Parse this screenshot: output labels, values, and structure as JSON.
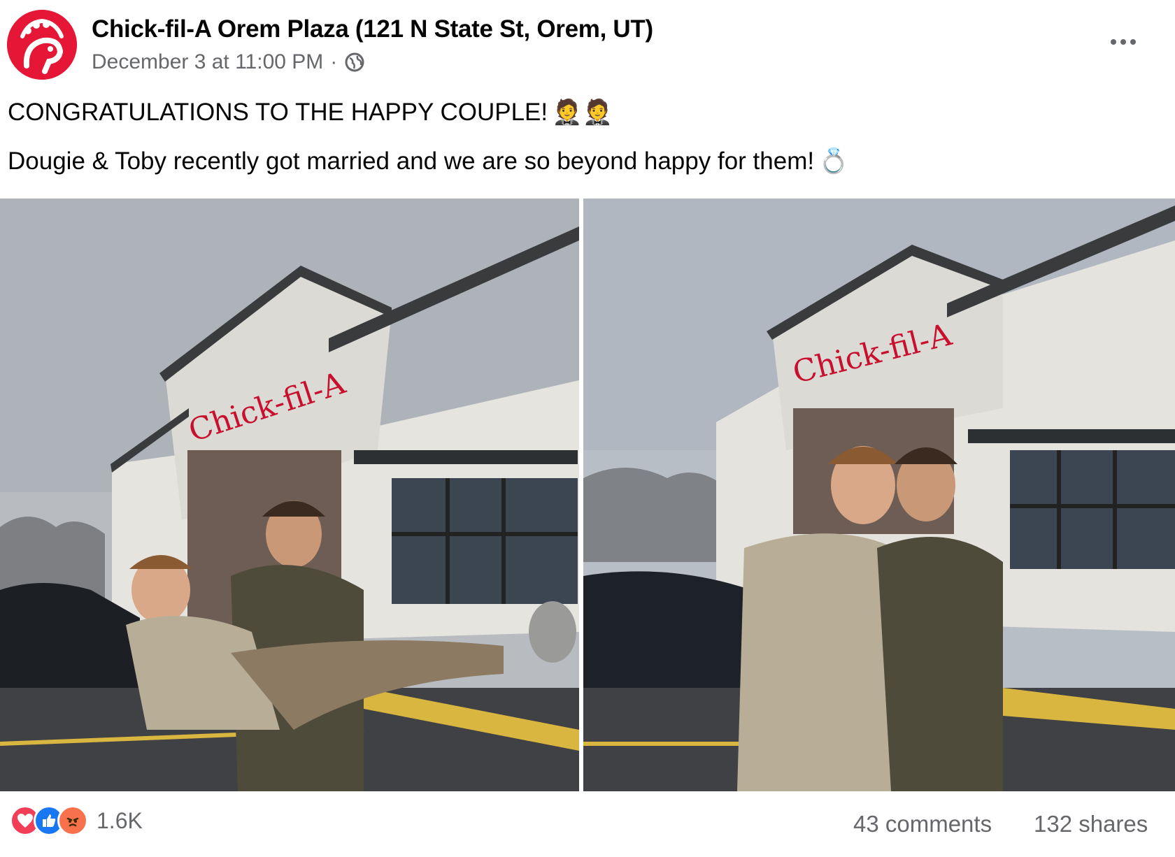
{
  "post": {
    "page_name": "Chick-fil-A Orem Plaza (121 N State St, Orem, UT)",
    "date": "December 3 at 11:00 PM",
    "separator": "·",
    "privacy_icon": "globe-icon",
    "more_icon": "more-options-icon",
    "text_line1": "CONGRATULATIONS TO THE HAPPY COUPLE!",
    "text_line1_emoji": "🤵🤵",
    "text_line2": "Dougie & Toby recently got married and we are so beyond happy for them!",
    "text_line2_emoji": "💍"
  },
  "photos": [
    {
      "icon": "photo-couple-carry"
    },
    {
      "icon": "photo-couple-hug"
    }
  ],
  "footer": {
    "reactions": [
      "love",
      "like",
      "angry"
    ],
    "reaction_count": "1.6K",
    "comments": "43 comments",
    "shares": "132 shares"
  },
  "colors": {
    "brand_red": "#e51636",
    "meta_gray": "#65676b",
    "like_blue": "#1877f2",
    "love_red": "#f33e58",
    "angry_orange": "#f7714c"
  }
}
